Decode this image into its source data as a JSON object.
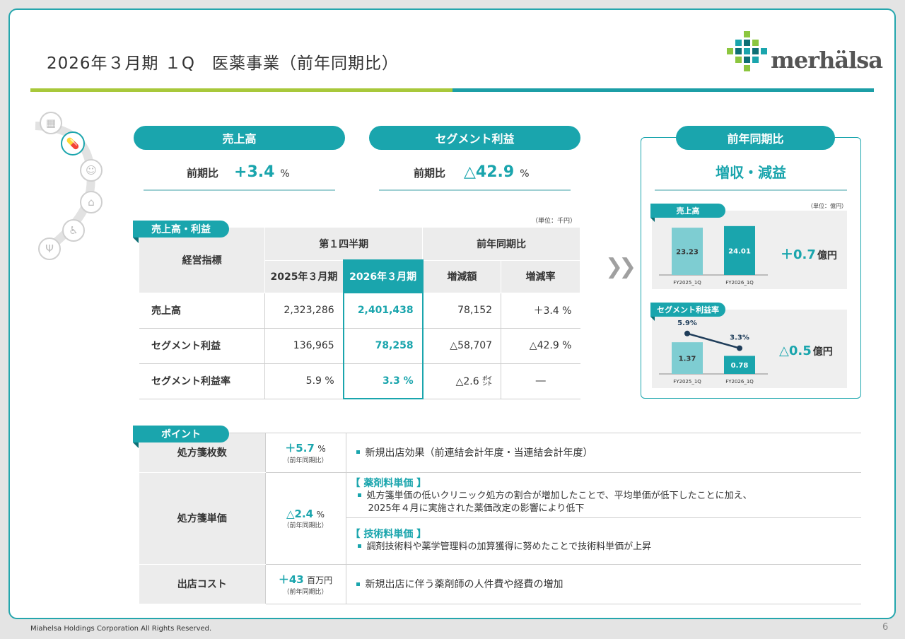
{
  "header": {
    "title": "2026年３月期 １Q　医薬事業（前年同期比）",
    "logo_text": "merhälsa"
  },
  "summary": {
    "sales": {
      "label": "売上高",
      "cmp_label": "前期比",
      "value": "+3.4",
      "unit": "%"
    },
    "segment": {
      "label": "セグメント利益",
      "cmp_label": "前期比",
      "value": "△42.9",
      "unit": "%"
    }
  },
  "yoy_panel": {
    "label": "前年同期比",
    "headline": "増収・減益",
    "unit_note": "（単位：億円）",
    "sales_tab": "売上高",
    "sales_delta_value": "＋0.7",
    "sales_delta_unit": "億円",
    "margin_tab": "セグメント利益率",
    "margin_delta_value": "△0.5",
    "margin_delta_unit": "億円"
  },
  "chart_data": [
    {
      "type": "bar",
      "categories": [
        "FY2025_1Q",
        "FY2026_1Q"
      ],
      "values": [
        23.23,
        24.01
      ],
      "title": "売上高",
      "ylim": [
        0,
        25
      ]
    },
    {
      "type": "bar",
      "categories": [
        "FY2025_1Q",
        "FY2026_1Q"
      ],
      "values": [
        1.37,
        0.78
      ],
      "line_values": [
        "5.9%",
        "3.3%"
      ],
      "line_numeric": [
        5.9,
        3.3
      ],
      "title": "セグメント利益率",
      "ylim": [
        0,
        2.2
      ]
    }
  ],
  "fin_table": {
    "tab": "売上高・利益",
    "unit_note": "（単位：千円）",
    "h_metric": "経営指標",
    "h_quarter": "第１四半期",
    "h_yoy": "前年同期比",
    "h_fy25": "2025年３月期",
    "h_fy26": "2026年３月期",
    "h_diff": "増減額",
    "h_rate": "増減率",
    "rows": [
      {
        "label": "売上高",
        "fy25": "2,323,286",
        "fy26": "2,401,438",
        "diff": "78,152",
        "rate": "＋3.4 %"
      },
      {
        "label": "セグメント利益",
        "fy25": "136,965",
        "fy26": "78,258",
        "diff": "△58,707",
        "rate": "△42.9 %"
      },
      {
        "label": "セグメント利益率",
        "fy25": "5.9 %",
        "fy26": "3.3 %",
        "diff": "△2.6 ㌽",
        "rate": "―"
      }
    ]
  },
  "points": {
    "tab": "ポイント",
    "yoy_note": "（前年同期比）",
    "rows": [
      {
        "label": "処方箋枚数",
        "value": "＋5.7",
        "unit": "%",
        "text": "新規出店効果（前連結会計年度・当連結会計年度）"
      },
      {
        "label": "処方箋単価",
        "value": "△2.4",
        "unit": "%",
        "sub1_title": "【 薬剤料単価 】",
        "sub1_text1": "処方箋単価の低いクリニック処方の割合が増加したことで、平均単価が低下したことに加え、",
        "sub1_text2": "2025年４月に実施された薬価改定の影響により低下",
        "sub2_title": "【 技術料単価 】",
        "sub2_text": "調剤技術料や薬学管理料の加算獲得に努めたことで技術料単価が上昇"
      },
      {
        "label": "出店コスト",
        "value": "＋43",
        "unit": "百万円",
        "text": "新規出店に伴う薬剤師の人件費や経費の増加"
      }
    ]
  },
  "footer": {
    "copyright": "Miahelsa Holdings Corporation All Rights Reserved.",
    "page": "6"
  }
}
